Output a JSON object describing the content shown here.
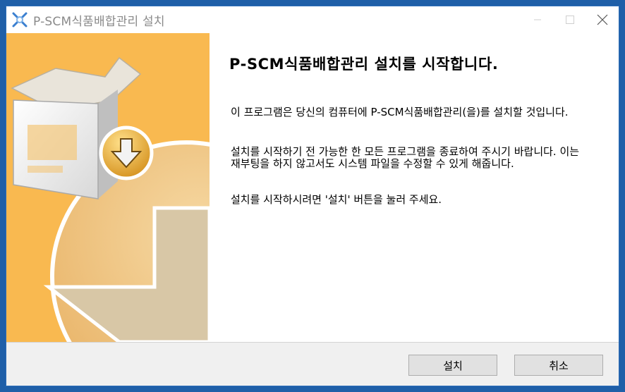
{
  "window": {
    "title": "P-SCM식품배합관리 설치",
    "controls": {
      "minimize_icon": "minimize-icon",
      "maximize_icon": "maximize-icon",
      "close_icon": "close-icon"
    }
  },
  "content": {
    "heading": "P-SCM식품배합관리 설치를 시작합니다.",
    "paragraph1": "이 프로그램은 당신의 컴퓨터에 P-SCM식품배합관리(을)를 설치할 것입니다.",
    "paragraph2": "설치를 시작하기 전 가능한 한 모든 프로그램을 종료하여 주시기 바랍니다. 이는 재부팅을 하지 않고서도 시스템 파일을 수정할 수 있게 해줍니다.",
    "paragraph3": "설치를 시작하시려면 '설치' 버튼을 눌러 주세요."
  },
  "buttons": {
    "install": "설치",
    "cancel": "취소"
  },
  "colors": {
    "banner_background": "#f9b950",
    "window_border": "#2b6cb8"
  }
}
